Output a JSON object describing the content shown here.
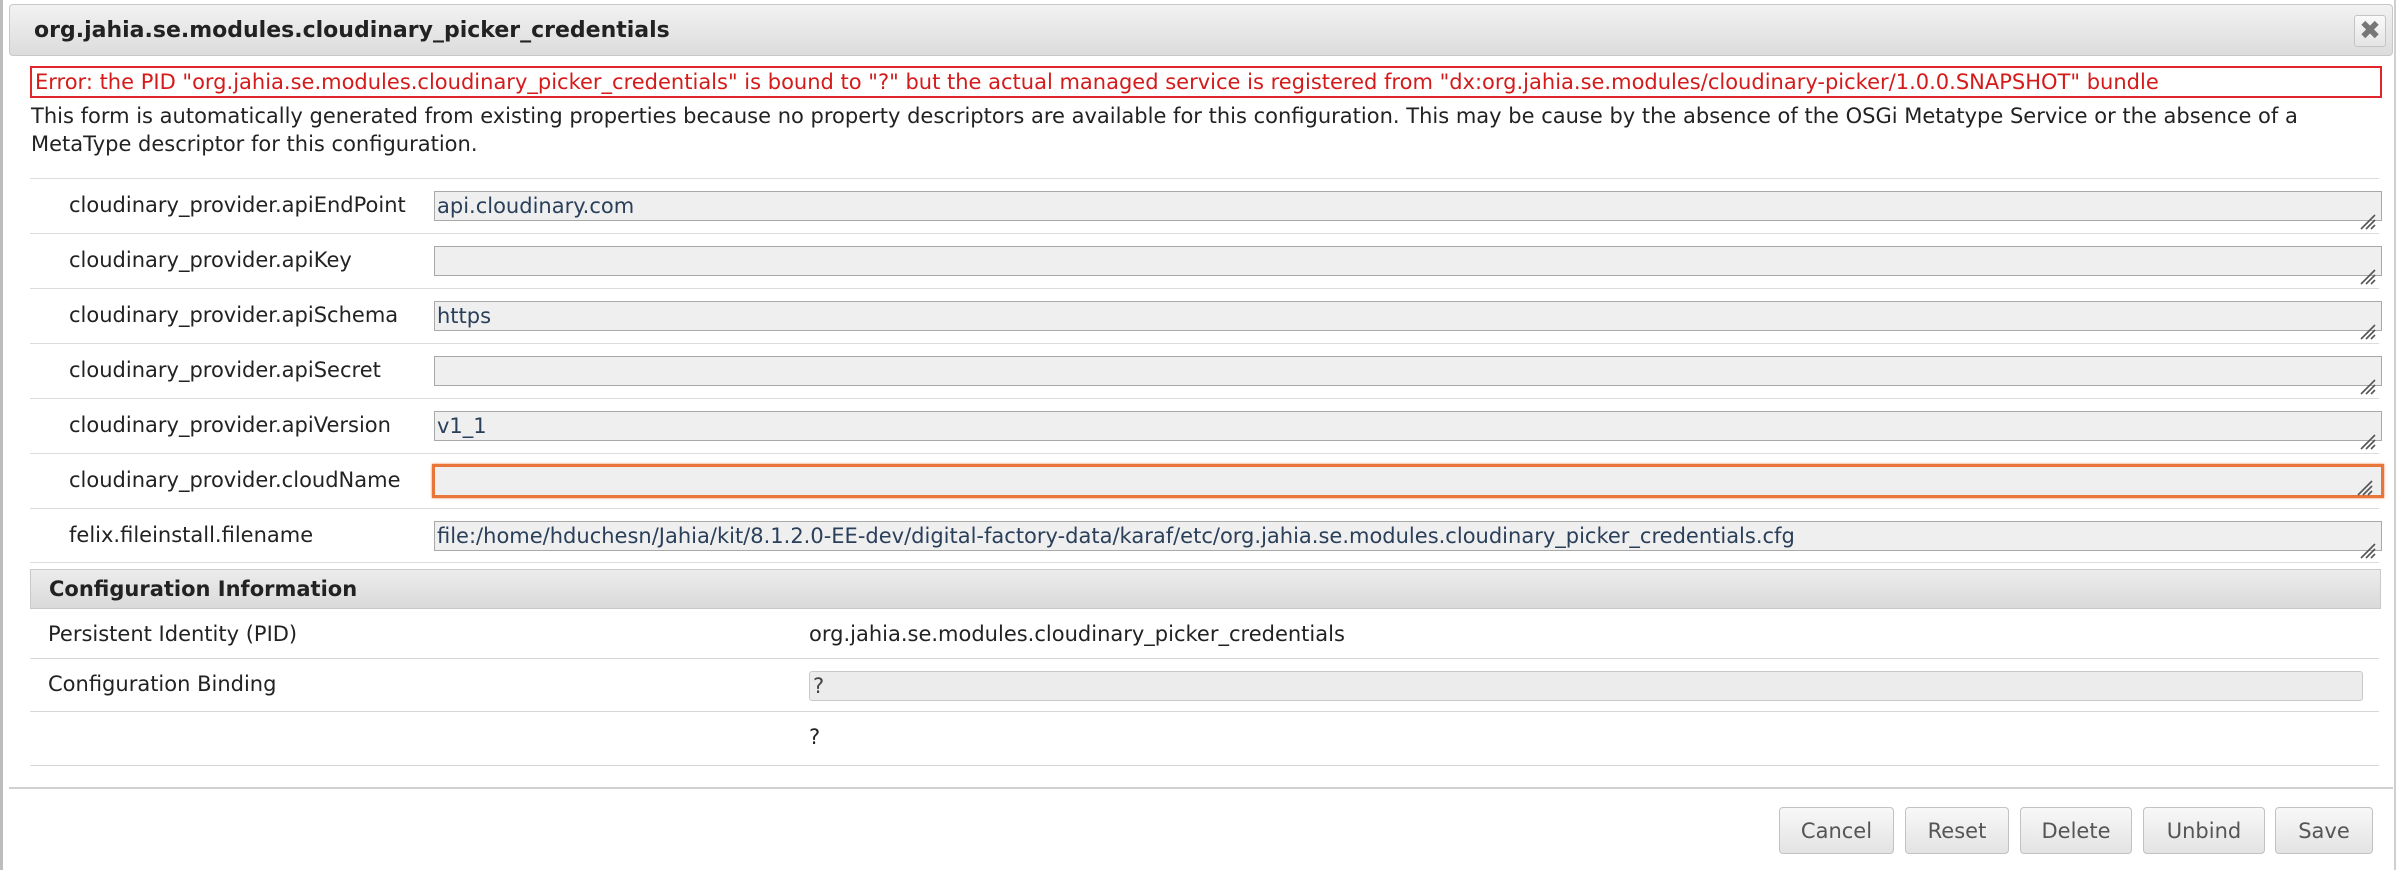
{
  "dialog": {
    "title": "org.jahia.se.modules.cloudinary_picker_credentials",
    "close_glyph": "✖",
    "error": "Error: the PID \"org.jahia.se.modules.cloudinary_picker_credentials\" is bound to \"?\" but the actual managed service is registered from \"dx:org.jahia.se.modules/cloudinary-picker/1.0.0.SNAPSHOT\" bundle",
    "info": "This form is automatically generated from existing properties because no property descriptors are available for this configuration. This may be cause by the absence of the OSGi Metatype Service or the absence of a MetaType descriptor for this configuration."
  },
  "properties": [
    {
      "label": "cloudinary_provider.apiEndPoint",
      "value": "api.cloudinary.com"
    },
    {
      "label": "cloudinary_provider.apiKey",
      "value": ""
    },
    {
      "label": "cloudinary_provider.apiSchema",
      "value": "https"
    },
    {
      "label": "cloudinary_provider.apiSecret",
      "value": ""
    },
    {
      "label": "cloudinary_provider.apiVersion",
      "value": "v1_1"
    },
    {
      "label": "cloudinary_provider.cloudName",
      "value": ""
    },
    {
      "label": "felix.fileinstall.filename",
      "value": "file:/home/hduchesn/Jahia/kit/8.1.2.0-EE-dev/digital-factory-data/karaf/etc/org.jahia.se.modules.cloudinary_picker_credentials.cfg"
    }
  ],
  "config_info": {
    "title": "Configuration Information",
    "pid_label": "Persistent Identity (PID)",
    "pid_value": "org.jahia.se.modules.cloudinary_picker_credentials",
    "binding_label": "Configuration Binding",
    "binding_value": "?",
    "extra_value": "?"
  },
  "buttons": {
    "cancel": "Cancel",
    "reset": "Reset",
    "delete": "Delete",
    "unbind": "Unbind",
    "save": "Save"
  },
  "colors": {
    "error": "#d51a1a",
    "focus_border": "#e8763a"
  }
}
